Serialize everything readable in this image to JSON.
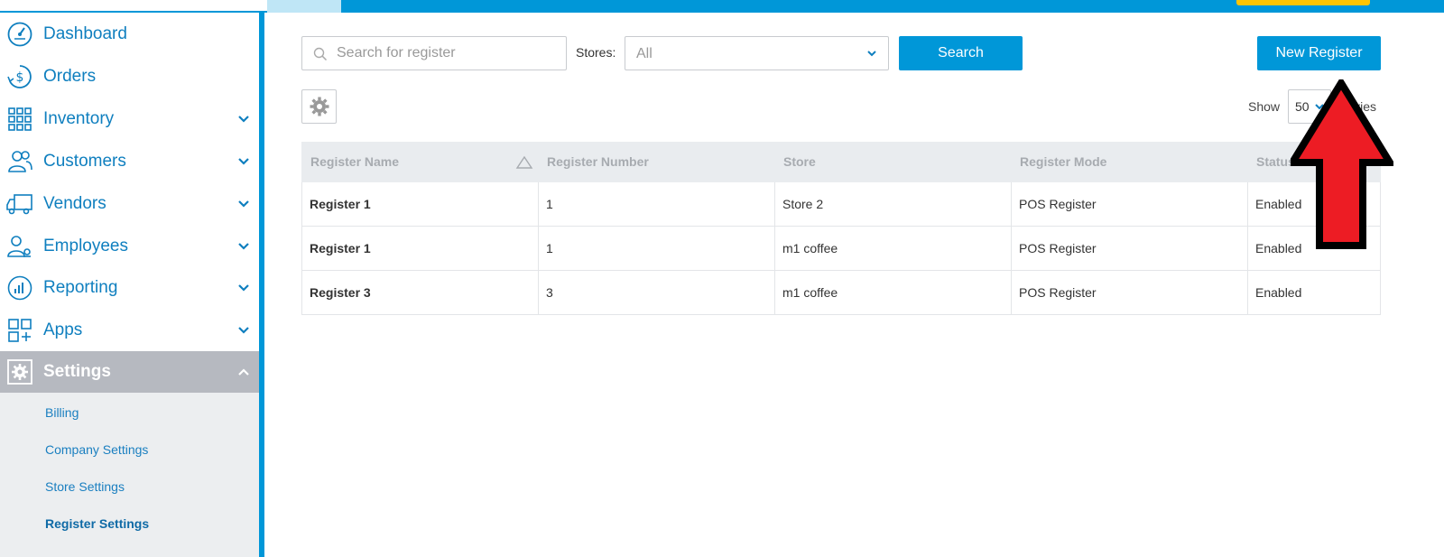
{
  "sidebar": {
    "items": [
      {
        "label": "Dashboard",
        "icon": "dashboard-gauge-icon",
        "has_chevron": false
      },
      {
        "label": "Orders",
        "icon": "orders-dollar-icon",
        "has_chevron": false
      },
      {
        "label": "Inventory",
        "icon": "inventory-grid-icon",
        "has_chevron": true
      },
      {
        "label": "Customers",
        "icon": "customers-icon",
        "has_chevron": true
      },
      {
        "label": "Vendors",
        "icon": "vendors-truck-icon",
        "has_chevron": true
      },
      {
        "label": "Employees",
        "icon": "employees-icon",
        "has_chevron": true
      },
      {
        "label": "Reporting",
        "icon": "reporting-chart-icon",
        "has_chevron": true
      },
      {
        "label": "Apps",
        "icon": "apps-icon",
        "has_chevron": true
      },
      {
        "label": "Settings",
        "icon": "settings-gear-icon",
        "has_chevron": true,
        "active": true
      }
    ],
    "sub_items": [
      {
        "label": "Billing"
      },
      {
        "label": "Company Settings"
      },
      {
        "label": "Store Settings"
      },
      {
        "label": "Register Settings",
        "active": true
      }
    ]
  },
  "toolbar": {
    "search_placeholder": "Search for register",
    "stores_label": "Stores:",
    "stores_value": "All",
    "search_button": "Search",
    "new_register_button": "New Register",
    "show_label": "Show",
    "show_value": "50",
    "entries_label": "entries"
  },
  "table": {
    "headers": [
      "Register Name",
      "Register Number",
      "Store",
      "Register Mode",
      "Status"
    ],
    "rows": [
      [
        "Register 1",
        "1",
        "Store 2",
        "POS Register",
        "Enabled"
      ],
      [
        "Register 1",
        "1",
        "m1 coffee",
        "POS Register",
        "Enabled"
      ],
      [
        "Register 3",
        "3",
        "m1 coffee",
        "POS Register",
        "Enabled"
      ]
    ]
  },
  "colors": {
    "brand_blue": "#0097d8",
    "nav_text": "#0f7fbf",
    "annotation_red": "#ed1c24"
  }
}
